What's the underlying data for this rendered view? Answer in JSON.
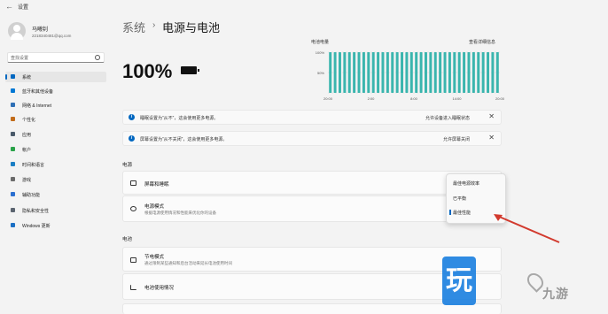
{
  "window": {
    "back_glyph": "←",
    "title": "设置"
  },
  "user": {
    "name": "马曦钊",
    "email": "2218340481@qq.com"
  },
  "search": {
    "placeholder": "查找设置"
  },
  "sidebar": {
    "items": [
      {
        "label": "系统",
        "icon": "monitor-icon",
        "color": "#0067c0",
        "active": true
      },
      {
        "label": "蓝牙和其他设备",
        "icon": "bluetooth-icon",
        "color": "#0078d4"
      },
      {
        "label": "网络 & Internet",
        "icon": "wifi-icon",
        "color": "#2e6fb5"
      },
      {
        "label": "个性化",
        "icon": "brush-icon",
        "color": "#c26c1a"
      },
      {
        "label": "应用",
        "icon": "apps-icon",
        "color": "#4a5a6a"
      },
      {
        "label": "帐户",
        "icon": "account-icon",
        "color": "#2aa34a"
      },
      {
        "label": "时间和语言",
        "icon": "globe-icon",
        "color": "#1b7fc4"
      },
      {
        "label": "游戏",
        "icon": "gamepad-icon",
        "color": "#6b6b6b"
      },
      {
        "label": "辅助功能",
        "icon": "accessibility-icon",
        "color": "#2a6fd0"
      },
      {
        "label": "隐私和安全性",
        "icon": "shield-icon",
        "color": "#5b6470"
      },
      {
        "label": "Windows 更新",
        "icon": "update-icon",
        "color": "#1b6fc4"
      }
    ]
  },
  "header": {
    "breadcrumb_parent": "系统",
    "separator": "›",
    "title": "电源与电池"
  },
  "battery": {
    "percent_text": "100%",
    "icon": "battery-full-icon"
  },
  "chart_data": {
    "type": "bar",
    "title": "电池电量",
    "link": "查看详细信息",
    "y_ticks": [
      "100%",
      "50%"
    ],
    "x_ticks": [
      "20:00",
      "2:00",
      "8:00",
      "14:00",
      "20:00"
    ],
    "ylim": [
      0,
      100
    ],
    "values": [
      100,
      100,
      100,
      100,
      100,
      100,
      100,
      100,
      100,
      100,
      100,
      100,
      100,
      100,
      100,
      100,
      100,
      100,
      100,
      100,
      100,
      100,
      100,
      100,
      100,
      100,
      100,
      100,
      100,
      100,
      100,
      100,
      100,
      100,
      100,
      100
    ],
    "bar_color": "#3ab5ae"
  },
  "banners": [
    {
      "text": "睡眠设置为“从不”，这会使用更多电源。",
      "link": "允许设备进入睡眠状态",
      "close": "✕"
    },
    {
      "text": "屏幕设置为“从不关闭”，这会使用更多电源。",
      "link": "允许屏幕关闭",
      "close": "✕"
    }
  ],
  "sections": {
    "power": "电源",
    "battery": "电池"
  },
  "cards": {
    "screen_sleep": {
      "title": "屏幕和睡眠",
      "chevron": "⌃"
    },
    "power_mode": {
      "title": "电源模式",
      "subtitle": "根据电源使用情况和性能来优化你的设备"
    },
    "battery_saver": {
      "title": "节电模式",
      "subtitle": "通过限制某些通知和后台活动来延长电池使用时间"
    },
    "battery_usage": {
      "title": "电池使用情况"
    }
  },
  "power_mode_menu": {
    "options": [
      "最佳电源效率",
      "已平衡",
      "最佳性能"
    ],
    "selected": "最佳性能"
  },
  "arrow_color": "#d23a2e",
  "watermark": {
    "badge": "玩",
    "text": "九游"
  }
}
